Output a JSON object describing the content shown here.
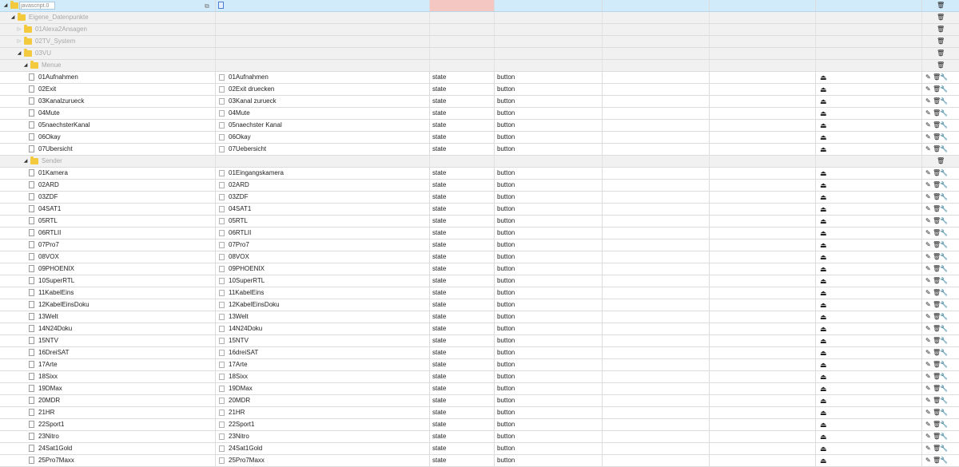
{
  "search": {
    "placeholder": "javascript.0"
  },
  "icons": {
    "toggle_open": "◢",
    "toggle_closed": "▷",
    "edit": "✎",
    "delete": "🗑",
    "wrench": "🔧",
    "push": "⏏",
    "copy": "⧉"
  },
  "tree": {
    "root_folder": "Eigene_Datenpunkte",
    "folders": [
      {
        "label": "01Alexa2Ansagen",
        "expanded": false
      },
      {
        "label": "02TV_System",
        "expanded": false
      },
      {
        "label": "03VU",
        "expanded": true
      }
    ],
    "menue": {
      "label": "Menue",
      "items": [
        {
          "id": "01Aufnahmen",
          "name": "01Aufnahmen",
          "type": "state",
          "role": "button"
        },
        {
          "id": "02Exit",
          "name": "02Exit druecken",
          "type": "state",
          "role": "button"
        },
        {
          "id": "03Kanalzurueck",
          "name": "03Kanal zurueck",
          "type": "state",
          "role": "button"
        },
        {
          "id": "04Mute",
          "name": "04Mute",
          "type": "state",
          "role": "button"
        },
        {
          "id": "05naechsterKanal",
          "name": "05naechster Kanal",
          "type": "state",
          "role": "button"
        },
        {
          "id": "06Okay",
          "name": "06Okay",
          "type": "state",
          "role": "button"
        },
        {
          "id": "07Ubersicht",
          "name": "07Uebersicht",
          "type": "state",
          "role": "button"
        }
      ]
    },
    "sender": {
      "label": "Sender",
      "items": [
        {
          "id": "01Kamera",
          "name": "01Eingangskamera",
          "type": "state",
          "role": "button"
        },
        {
          "id": "02ARD",
          "name": "02ARD",
          "type": "state",
          "role": "button"
        },
        {
          "id": "03ZDF",
          "name": "03ZDF",
          "type": "state",
          "role": "button"
        },
        {
          "id": "04SAT1",
          "name": "04SAT1",
          "type": "state",
          "role": "button"
        },
        {
          "id": "05RTL",
          "name": "05RTL",
          "type": "state",
          "role": "button"
        },
        {
          "id": "06RTLII",
          "name": "06RTLII",
          "type": "state",
          "role": "button"
        },
        {
          "id": "07Pro7",
          "name": "07Pro7",
          "type": "state",
          "role": "button"
        },
        {
          "id": "08VOX",
          "name": "08VOX",
          "type": "state",
          "role": "button"
        },
        {
          "id": "09PHOENIX",
          "name": "09PHOENIX",
          "type": "state",
          "role": "button"
        },
        {
          "id": "10SuperRTL",
          "name": "10SuperRTL",
          "type": "state",
          "role": "button"
        },
        {
          "id": "11KabelEins",
          "name": "11KabelEins",
          "type": "state",
          "role": "button"
        },
        {
          "id": "12KabelEinsDoku",
          "name": "12KabelEinsDoku",
          "type": "state",
          "role": "button"
        },
        {
          "id": "13Welt",
          "name": "13Welt",
          "type": "state",
          "role": "button"
        },
        {
          "id": "14N24Doku",
          "name": "14N24Doku",
          "type": "state",
          "role": "button"
        },
        {
          "id": "15NTV",
          "name": "15NTV",
          "type": "state",
          "role": "button"
        },
        {
          "id": "16DreiSAT",
          "name": "16dreiSAT",
          "type": "state",
          "role": "button"
        },
        {
          "id": "17Arte",
          "name": "17Arte",
          "type": "state",
          "role": "button"
        },
        {
          "id": "18Sixx",
          "name": "18Sixx",
          "type": "state",
          "role": "button"
        },
        {
          "id": "19DMax",
          "name": "19DMax",
          "type": "state",
          "role": "button"
        },
        {
          "id": "20MDR",
          "name": "20MDR",
          "type": "state",
          "role": "button"
        },
        {
          "id": "21HR",
          "name": "21HR",
          "type": "state",
          "role": "button"
        },
        {
          "id": "22Sport1",
          "name": "22Sport1",
          "type": "state",
          "role": "button"
        },
        {
          "id": "23Nitro",
          "name": "23Nitro",
          "type": "state",
          "role": "button"
        },
        {
          "id": "24Sat1Gold",
          "name": "24Sat1Gold",
          "type": "state",
          "role": "button"
        },
        {
          "id": "25Pro7Maxx",
          "name": "25Pro7Maxx",
          "type": "state",
          "role": "button"
        }
      ]
    }
  }
}
